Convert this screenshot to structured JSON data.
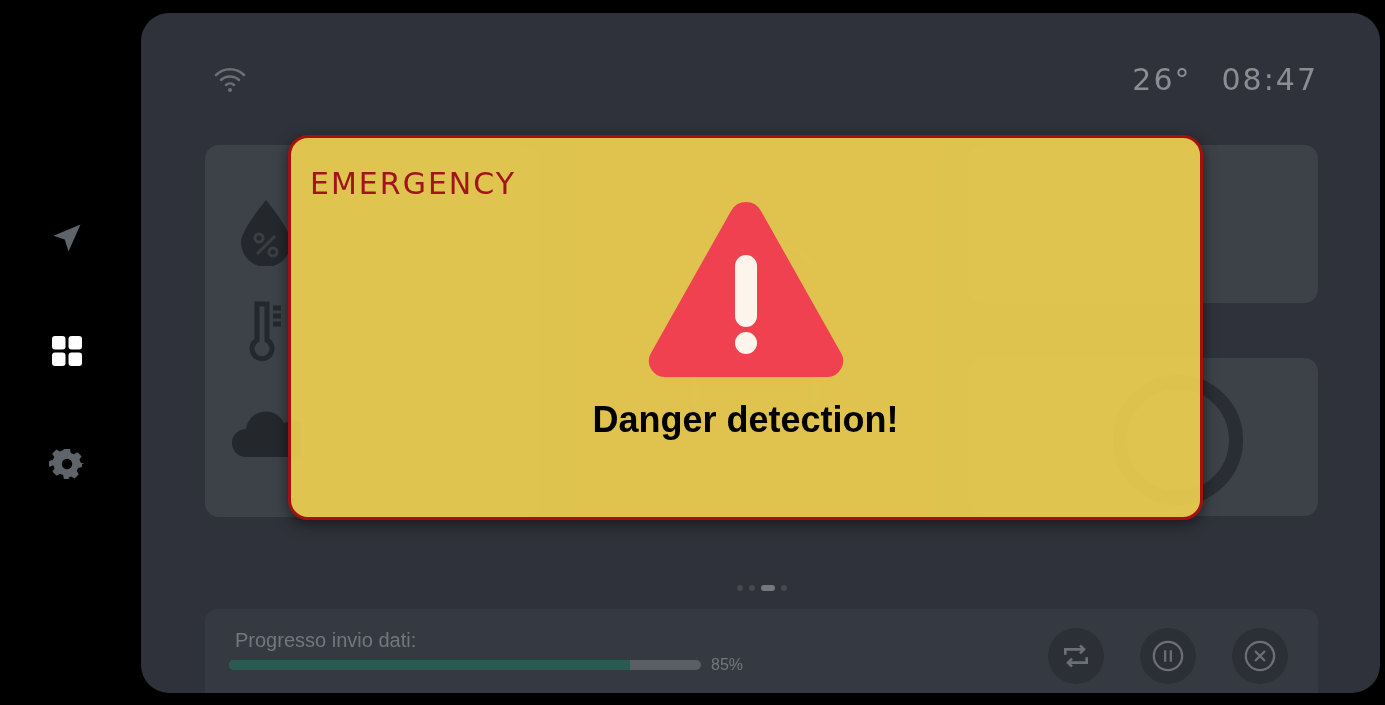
{
  "sidebar": {
    "items": [
      {
        "kind": "navigate",
        "selected": false
      },
      {
        "kind": "dashboard",
        "selected": true
      },
      {
        "kind": "settings",
        "selected": false
      }
    ]
  },
  "status_bar": {
    "temperature": "26°",
    "time": "08:47"
  },
  "sensors": [
    {
      "kind": "humidity"
    },
    {
      "kind": "temperature"
    },
    {
      "kind": "co2"
    }
  ],
  "pager": [
    {
      "selected": false
    },
    {
      "selected": false
    },
    {
      "selected": true
    },
    {
      "selected": false
    }
  ],
  "upload": {
    "label": "Progresso invio dati:",
    "level": 0.85,
    "reading": "85%"
  },
  "actions": [
    {
      "kind": "retry"
    },
    {
      "kind": "pause"
    },
    {
      "kind": "cancel"
    }
  ],
  "alert": {
    "title": "EMERGENCY",
    "message": "Danger detection!"
  }
}
